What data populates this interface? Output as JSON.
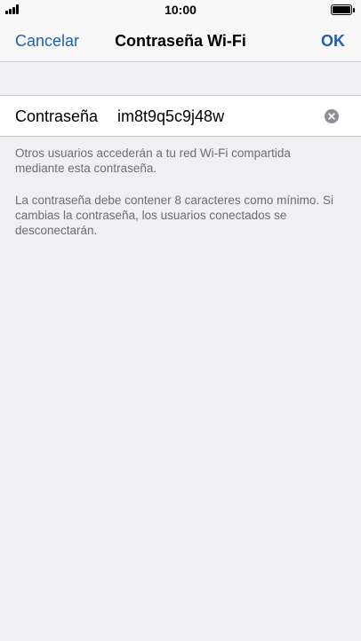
{
  "status_bar": {
    "time": "10:00",
    "signal_icon": "signal-bars-icon",
    "battery_icon": "battery-full-icon"
  },
  "nav": {
    "cancel_label": "Cancelar",
    "title": "Contraseña Wi-Fi",
    "ok_label": "OK",
    "accent_color": "#1f5fb7"
  },
  "password_field": {
    "label": "Contraseña",
    "value": "im8t9q5c9j48w",
    "clear_icon": "clear-circle-icon"
  },
  "notes": {
    "shared_info": "Otros usuarios accederán a tu red Wi-Fi compartida mediante esta contraseña.",
    "requirements": "La contraseña debe contener 8 caracteres como mínimo. Si cambias la contraseña, los usuarios conectados se desconectarán."
  }
}
